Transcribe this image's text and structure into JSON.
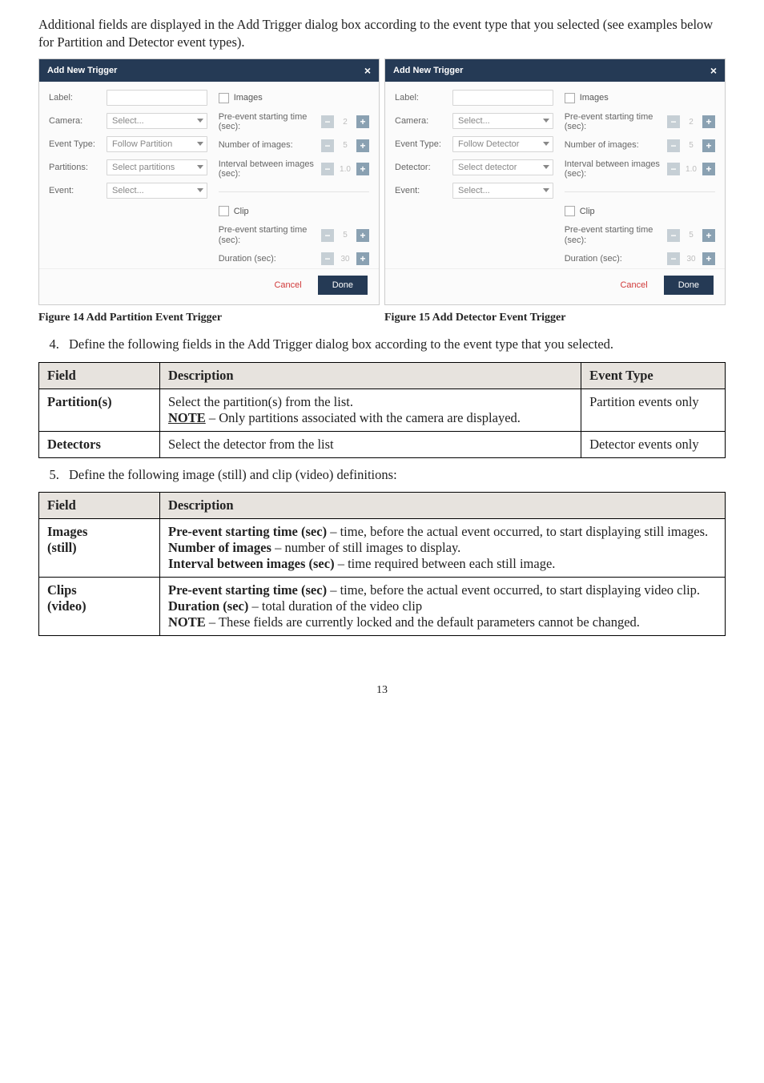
{
  "intro": "Additional fields are displayed in the Add Trigger dialog box according to the event type that you selected (see examples below for Partition and Detector event types).",
  "dialogA": {
    "title": "Add New Trigger",
    "rows": {
      "label_lbl": "Label:",
      "camera_lbl": "Camera:",
      "camera_val": "Select...",
      "evtype_lbl": "Event Type:",
      "evtype_val": "Follow Partition",
      "partitions_lbl": "Partitions:",
      "partitions_val": "Select partitions",
      "event_lbl": "Event:",
      "event_val": "Select..."
    },
    "right": {
      "images_chk": "Images",
      "pre1": "Pre-event starting time (sec):",
      "pre1_v": "2",
      "num_img": "Number of images:",
      "num_img_v": "5",
      "interval": "Interval between images (sec):",
      "interval_v": "1.0",
      "clip_chk": "Clip",
      "pre2": "Pre-event starting time (sec):",
      "pre2_v": "5",
      "dur": "Duration (sec):",
      "dur_v": "30"
    },
    "cancel": "Cancel",
    "done": "Done"
  },
  "dialogB": {
    "title": "Add New Trigger",
    "rows": {
      "label_lbl": "Label:",
      "camera_lbl": "Camera:",
      "camera_val": "Select...",
      "evtype_lbl": "Event Type:",
      "evtype_val": "Follow Detector",
      "detector_lbl": "Detector:",
      "detector_val": "Select detector",
      "event_lbl": "Event:",
      "event_val": "Select..."
    },
    "right": {
      "images_chk": "Images",
      "pre1": "Pre-event starting time (sec):",
      "pre1_v": "2",
      "num_img": "Number of images:",
      "num_img_v": "5",
      "interval": "Interval between images (sec):",
      "interval_v": "1.0",
      "clip_chk": "Clip",
      "pre2": "Pre-event starting time (sec):",
      "pre2_v": "5",
      "dur": "Duration (sec):",
      "dur_v": "30"
    },
    "cancel": "Cancel",
    "done": "Done"
  },
  "fig14": "Figure 14 Add Partition Event Trigger",
  "fig15": "Figure 15 Add Detector Event Trigger",
  "step4": "Define the following fields in the Add Trigger dialog box according to the event type that you selected.",
  "table1": {
    "h1": "Field",
    "h2": "Description",
    "h3": "Event Type",
    "r1c1": "Partition(s)",
    "r1c2a": "Select the partition(s) from the list.",
    "r1c2b_pref": "NOTE",
    "r1c2b_rest": " – Only partitions associated with the camera are displayed.",
    "r1c3": "Partition events only",
    "r2c1": "Detectors",
    "r2c2": "Select the detector from the list",
    "r2c3": "Detector events only"
  },
  "step5": "Define the following image (still) and clip (video) definitions:",
  "table2": {
    "h1": "Field",
    "h2": "Description",
    "r1c1a": "Images",
    "r1c1b": "(still)",
    "r1_l1b": "Pre-event starting time (sec)",
    "r1_l1r": " – time, before the actual event occurred, to start displaying still images.",
    "r1_l2b": "Number of images",
    "r1_l2r": " – number of still images to display.",
    "r1_l3b": "Interval between images (sec)",
    "r1_l3r": " – time required between each still image.",
    "r2c1a": "Clips",
    "r2c1b": "(video)",
    "r2_l1b": "Pre-event starting time (sec)",
    "r2_l1r": " – time, before the actual event occurred, to start displaying video clip.",
    "r2_l2b": "Duration (sec)",
    "r2_l2r": " – total duration of the video clip",
    "r2_l3b": "NOTE",
    "r2_l3r": " – These fields are currently locked and the default parameters cannot be changed."
  },
  "page_num": "13"
}
